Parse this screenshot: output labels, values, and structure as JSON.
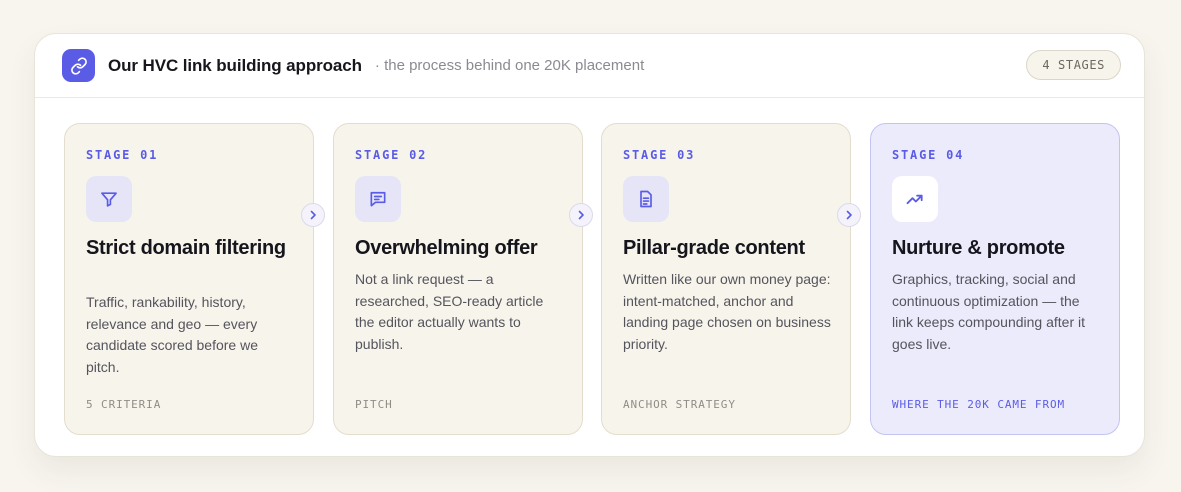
{
  "header": {
    "title": "Our HVC link building approach",
    "subtitle": "· the process behind one 20K placement",
    "badge": "4 STAGES",
    "logo_icon": "link-icon"
  },
  "colors": {
    "accent": "#5b5ce6",
    "page_bg": "#f8f5ef",
    "card_bg": "#f7f4ec",
    "highlight_bg": "#ebebfc"
  },
  "stages": [
    {
      "label": "STAGE 01",
      "icon": "filter-icon",
      "title": "Strict domain filtering",
      "description": "Traffic, rankability, history, relevance and geo — every candidate scored before we pitch.",
      "footer": "5 CRITERIA"
    },
    {
      "label": "STAGE 02",
      "icon": "message-icon",
      "title": "Overwhelming offer",
      "description": "Not a link request — a researched, SEO-ready article the editor actually wants to publish.",
      "footer": "PITCH"
    },
    {
      "label": "STAGE 03",
      "icon": "document-icon",
      "title": "Pillar-grade content",
      "description": "Written like our own money page: intent-matched, anchor and landing page chosen on business priority.",
      "footer": "ANCHOR STRATEGY"
    },
    {
      "label": "STAGE 04",
      "icon": "trending-up-icon",
      "title": "Nurture & promote",
      "description": "Graphics, tracking, social and continuous optimization — the link keeps compounding after it goes live.",
      "footer": "WHERE THE 20K CAME FROM"
    }
  ]
}
